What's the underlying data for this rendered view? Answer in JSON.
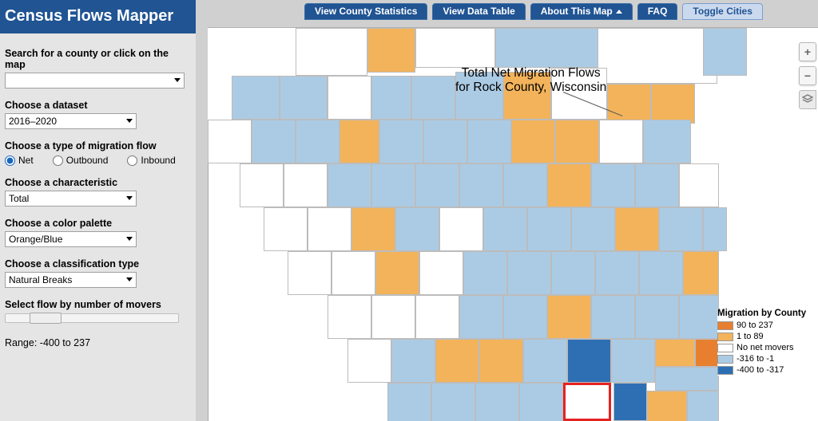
{
  "app": {
    "title": "Census Flows Mapper"
  },
  "tabs": {
    "stats": "View County Statistics",
    "table": "View Data Table",
    "about": "About This Map",
    "faq": "FAQ",
    "toggle": "Toggle Cities"
  },
  "sidebar": {
    "search_label": "Search for a county or click on the map",
    "search_value": "",
    "dataset_label": "Choose a dataset",
    "dataset_value": "2016–2020",
    "flowtype_label": "Choose a type of migration flow",
    "flowtype_options": {
      "net": "Net",
      "out": "Outbound",
      "in": "Inbound"
    },
    "characteristic_label": "Choose a characteristic",
    "characteristic_value": "Total",
    "palette_label": "Choose a color palette",
    "palette_value": "Orange/Blue",
    "classification_label": "Choose a classification type",
    "classification_value": "Natural Breaks",
    "slider_label": "Select flow by number of movers",
    "range_text": "Range: -400 to 237"
  },
  "map": {
    "title_line1": "Total Net Migration Flows",
    "title_line2": "for Rock County, Wisconsin",
    "zoom_in": "+",
    "zoom_out": "−"
  },
  "legend": {
    "title": "Migration by County",
    "bins": [
      {
        "color": "#e77f2f",
        "label": "90 to 237"
      },
      {
        "color": "#f2b35b",
        "label": "1 to 89"
      },
      {
        "color": "#ffffff",
        "label": "No net movers"
      },
      {
        "color": "#abcbe4",
        "label": "-316 to -1"
      },
      {
        "color": "#2e6fb4",
        "label": "-400 to -317"
      }
    ]
  }
}
